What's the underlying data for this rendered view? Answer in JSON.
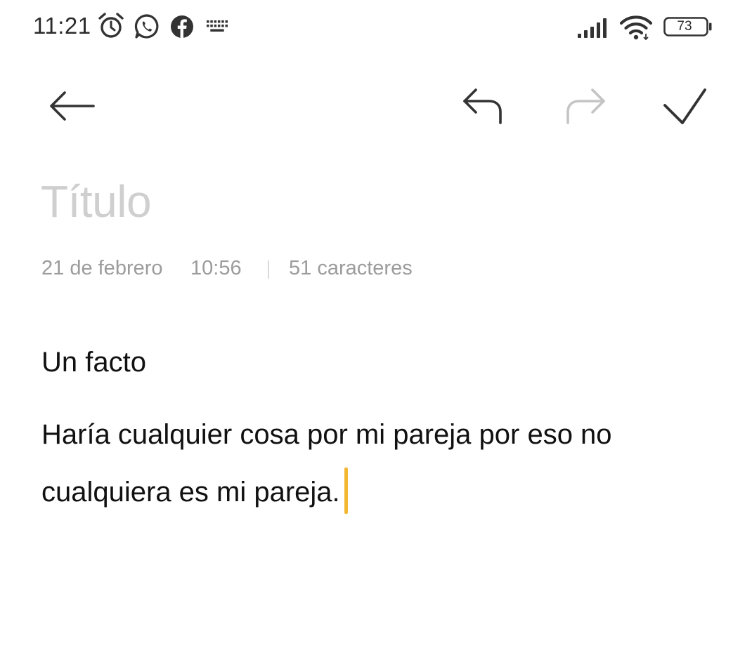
{
  "status_bar": {
    "time": "11:21",
    "notification_icons": [
      "alarm-icon",
      "whatsapp-icon",
      "facebook-icon",
      "keyboard-icon"
    ],
    "signal_icon": "signal-icon",
    "wifi_icon": "wifi-icon",
    "battery_level": "73"
  },
  "toolbar": {
    "back_icon": "back-arrow-icon",
    "undo_icon": "undo-icon",
    "redo_icon": "redo-icon",
    "redo_enabled": false,
    "confirm_icon": "check-icon"
  },
  "note": {
    "title_placeholder": "Título",
    "date": "21 de febrero",
    "time": "10:56",
    "char_count": "51 caracteres",
    "line1": "Un facto",
    "paragraph_line1": "Haría cualquier cosa por mi pareja por eso no",
    "paragraph_line2": "cualquiera es mi pareja."
  },
  "colors": {
    "text_primary": "#111111",
    "placeholder": "#cfcfcf",
    "meta_text": "#9c9c9c",
    "icon_active": "#333333",
    "icon_disabled": "#c4c4c4",
    "cursor": "#f4b731"
  }
}
